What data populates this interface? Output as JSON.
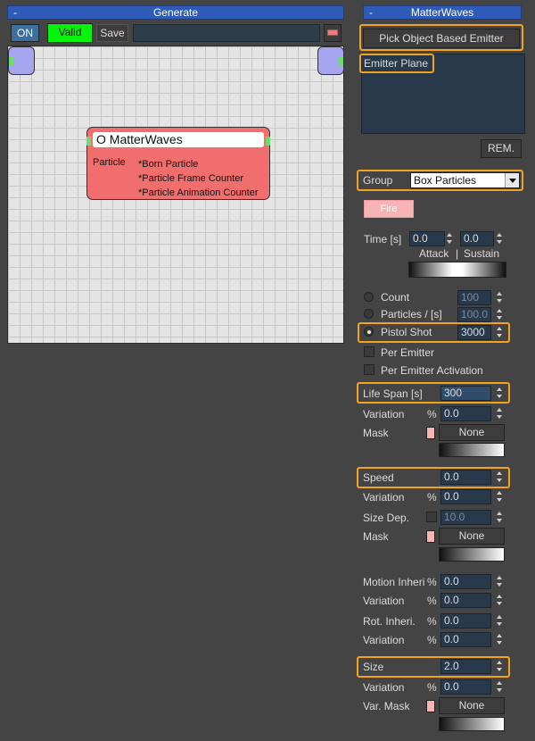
{
  "left_rollout": {
    "collapse_glyph": "-",
    "title": "Generate"
  },
  "toolbar": {
    "on_label": "ON",
    "valid_label": "Valid",
    "save_label": "Save",
    "name_value": ""
  },
  "graph": {
    "node": {
      "title": "O MatterWaves",
      "category": "Particle",
      "outputs": [
        "*Born Particle",
        "*Particle Frame Counter",
        "*Particle Animation Counter"
      ]
    }
  },
  "right_rollout": {
    "collapse_glyph": "-",
    "title": "MatterWaves"
  },
  "emitters": {
    "pick_button": "Pick Object Based Emitter",
    "items": [
      "Emitter Plane"
    ],
    "remove_button": "REM."
  },
  "group": {
    "label": "Group",
    "value": "Box Particles"
  },
  "fire_button": "Fire",
  "time": {
    "label": "Time [s]",
    "attack": "0.0",
    "sustain": "0.0",
    "attack_label": "Attack",
    "separator": "|",
    "sustain_label": "Sustain"
  },
  "emission": {
    "count": {
      "label": "Count",
      "value": "100"
    },
    "particles_per_s": {
      "label": "Particles  /  [s]",
      "value": "100.0"
    },
    "pistol_shot": {
      "label": "Pistol Shot",
      "value": "3000"
    },
    "per_emitter_label": "Per Emitter",
    "per_emitter_activation_label": "Per Emitter Activation"
  },
  "life_span": {
    "label": "Life Span [s]",
    "value": "300",
    "variation_label": "Variation",
    "variation_value": "0.0",
    "mask_label": "Mask",
    "mask_value": "None"
  },
  "speed": {
    "label": "Speed",
    "value": "0.0",
    "variation_label": "Variation",
    "variation_value": "0.0",
    "size_dep_label": "Size Dep.",
    "size_dep_value": "10.0",
    "mask_label": "Mask",
    "mask_value": "None"
  },
  "motion": {
    "motion_inherit_label": "Motion Inheri",
    "motion_inherit_value": "0.0",
    "variation1_label": "Variation",
    "variation1_value": "0.0",
    "rot_inherit_label": "Rot. Inheri.",
    "rot_inherit_value": "0.0",
    "variation2_label": "Variation",
    "variation2_value": "0.0"
  },
  "size": {
    "label": "Size",
    "value": "2.0",
    "variation_label": "Variation",
    "variation_value": "0.0",
    "mask_label": "Var. Mask",
    "mask_value": "None"
  },
  "pct_symbol": "%",
  "colors": {
    "highlight": "#f3a21c",
    "title_bar": "#2f5bb8",
    "valid": "#06f40c",
    "node": "#f06e6e",
    "io_node": "#a6a6f0",
    "swatch": "#f6b4b4"
  }
}
